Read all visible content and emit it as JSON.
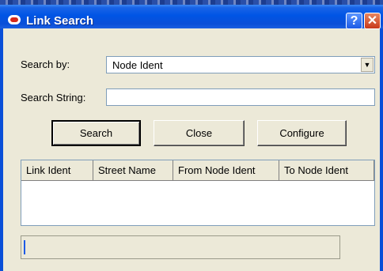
{
  "window": {
    "title": "Link Search",
    "help_glyph": "?",
    "close_glyph": "✕"
  },
  "form": {
    "search_by_label": "Search by:",
    "search_by_value": "Node Ident",
    "search_string_label": "Search String:",
    "search_string_value": ""
  },
  "buttons": {
    "search": "Search",
    "close": "Close",
    "configure": "Configure"
  },
  "results": {
    "columns": [
      "Link Ident",
      "Street Name",
      "From Node Ident",
      "To Node Ident"
    ],
    "rows": []
  },
  "status": {
    "text": ""
  },
  "icons": {
    "app": "oracle-logo-icon",
    "dropdown": "chevron-down-icon"
  },
  "colors": {
    "titlebar": "#0055e5",
    "close_button": "#c8391a",
    "dialog_bg": "#ece9d8"
  }
}
